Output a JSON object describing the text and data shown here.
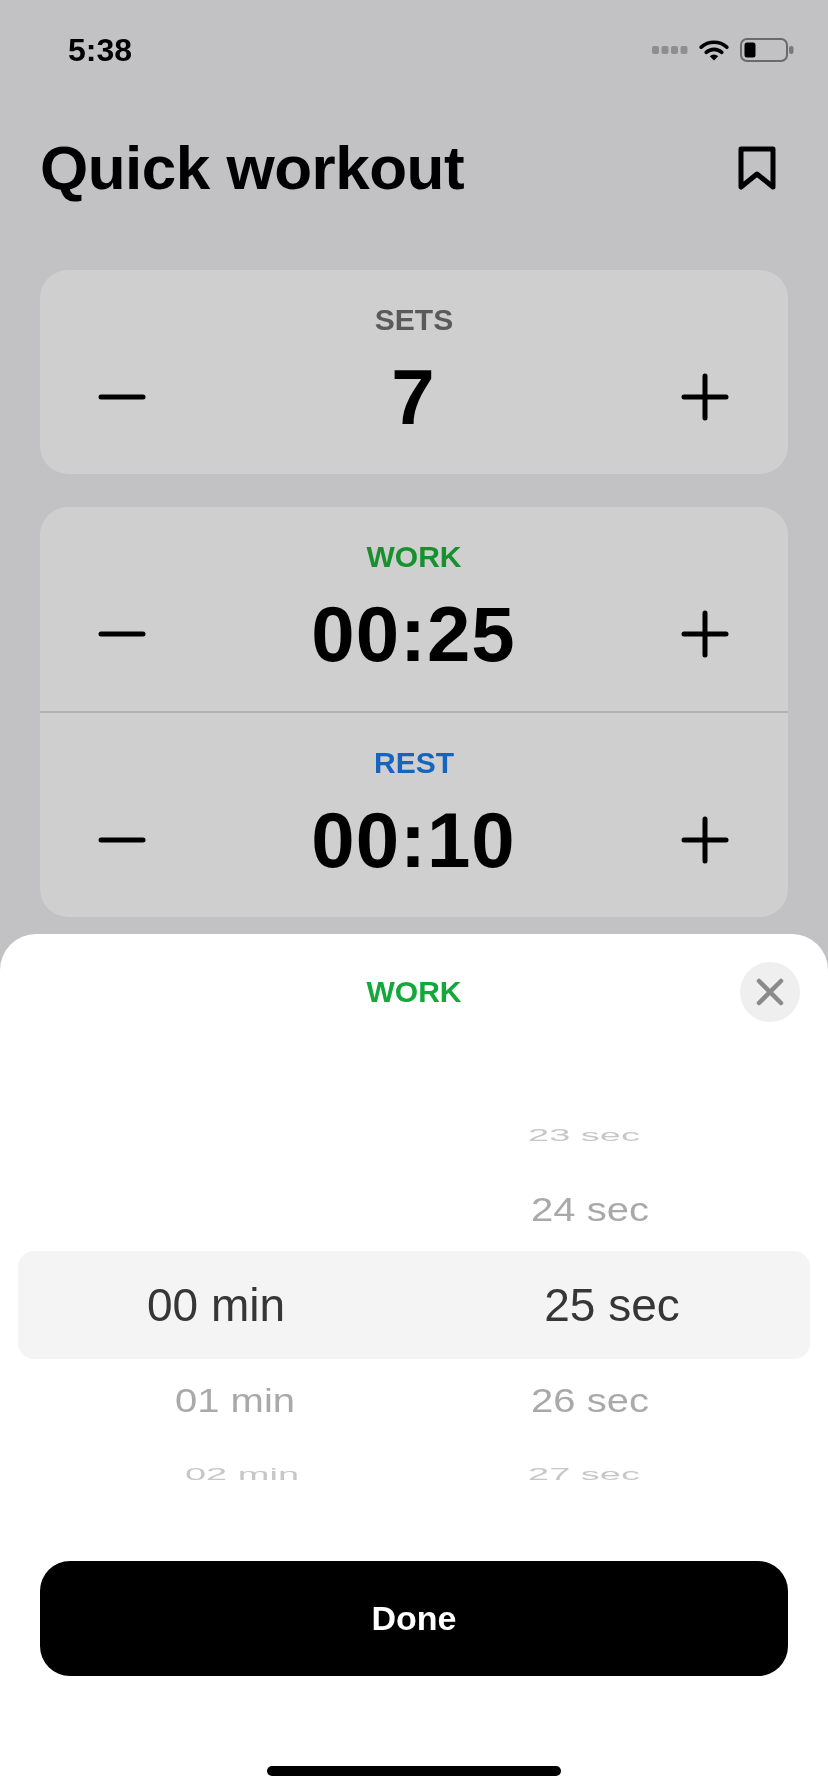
{
  "status_bar": {
    "time": "5:38"
  },
  "header": {
    "title": "Quick workout"
  },
  "cards": [
    {
      "rows": [
        {
          "label": "SETS",
          "value": "7",
          "color": "#5a5a5a"
        }
      ]
    },
    {
      "rows": [
        {
          "label": "WORK",
          "value": "00:25",
          "color": "#17912f"
        },
        {
          "label": "REST",
          "value": "00:10",
          "color": "#1565c0"
        }
      ]
    }
  ],
  "sheet": {
    "title": "WORK",
    "picker": {
      "columns": [
        {
          "items": [
            {
              "label": "00 min",
              "selected": true
            },
            {
              "label": "01 min",
              "selected": false
            },
            {
              "label": "02 min",
              "selected": false
            }
          ]
        },
        {
          "items": [
            {
              "label": "23 sec",
              "selected": false
            },
            {
              "label": "24 sec",
              "selected": false
            },
            {
              "label": "25 sec",
              "selected": true
            },
            {
              "label": "26 sec",
              "selected": false
            },
            {
              "label": "27 sec",
              "selected": false
            }
          ]
        }
      ]
    },
    "button": "Done"
  }
}
